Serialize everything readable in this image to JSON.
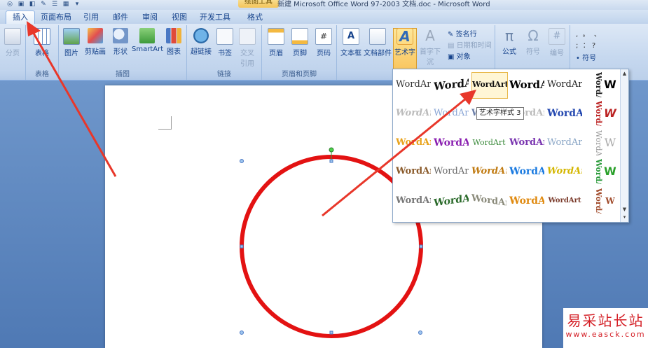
{
  "window": {
    "context_tab": "绘图工具",
    "title": "新建 Microsoft Office Word 97-2003 文档.doc - Microsoft Word"
  },
  "tabs": [
    {
      "label": "插入",
      "active": true
    },
    {
      "label": "页面布局"
    },
    {
      "label": "引用"
    },
    {
      "label": "邮件"
    },
    {
      "label": "审阅"
    },
    {
      "label": "视图"
    },
    {
      "label": "开发工具"
    },
    {
      "label": "格式"
    }
  ],
  "ribbon": {
    "groups": {
      "pages": {
        "label": ""
      },
      "tables": {
        "label": "表格"
      },
      "illustrations": {
        "label": "插图"
      },
      "links": {
        "label": "链接"
      },
      "header_footer": {
        "label": "页眉和页脚"
      },
      "text": {
        "label": ""
      },
      "symbols": {
        "label": ""
      }
    },
    "buttons": {
      "page_break": "分页",
      "table": "表格",
      "picture": "图片",
      "clip_art": "剪贴画",
      "shapes": "形状",
      "smartart": "SmartArt",
      "chart": "图表",
      "hyperlink": "超链接",
      "bookmark": "书签",
      "cross_ref_1": "交叉",
      "cross_ref_2": "引用",
      "header": "页眉",
      "footer": "页脚",
      "page_number": "页码",
      "text_box": "文本框",
      "quick_parts": "文档部件",
      "wordart": "艺术字",
      "drop_cap": "首字下沉",
      "signature_line": "签名行",
      "date_time": "日期和时间",
      "object": "对象",
      "equation": "公式",
      "symbol": "符号",
      "number": "编号",
      "symbol2": "符号"
    }
  },
  "gallery": {
    "sample_text": "WordArt",
    "tooltip": "艺术字样式 3",
    "colors": {
      "accent_hover": "#e8b84a",
      "highlight_circle": "#e31212",
      "arrow": "#e8372a"
    }
  },
  "watermark": {
    "name": "易采站长站",
    "url": "www.easck.com"
  }
}
